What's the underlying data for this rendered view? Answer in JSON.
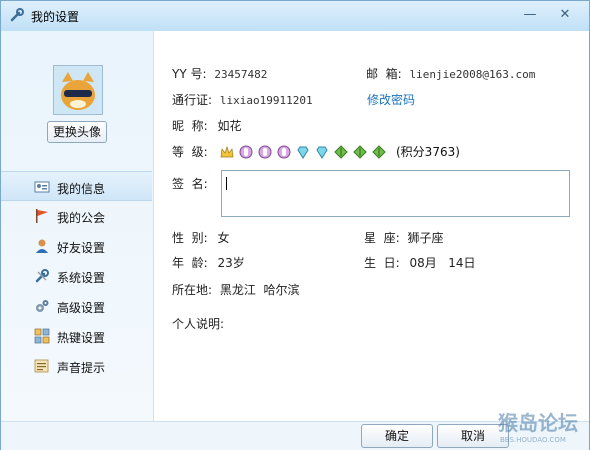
{
  "window": {
    "title": "我的设置",
    "min_icon": "minimize-icon",
    "close_icon": "close-icon"
  },
  "left": {
    "change_avatar_label": "更换头像",
    "nav": [
      {
        "label": "我的信息",
        "icon": "id-card-icon",
        "active": true
      },
      {
        "label": "我的公会",
        "icon": "flag-icon"
      },
      {
        "label": "好友设置",
        "icon": "user-icon"
      },
      {
        "label": "系统设置",
        "icon": "tools-icon"
      },
      {
        "label": "高级设置",
        "icon": "gears-icon"
      },
      {
        "label": "热键设置",
        "icon": "keys-icon"
      },
      {
        "label": "声音提示",
        "icon": "sound-icon"
      }
    ]
  },
  "info": {
    "yy_label": "YY 号:",
    "yy_value": "23457482",
    "email_label": "邮  箱:",
    "email_value": "lienjie2008@163.com",
    "pass_label": "通行证:",
    "pass_value": "lixiao19911201",
    "change_password": "修改密码",
    "nick_label": "昵  称:",
    "nick_value": "如花",
    "level_label": "等  级:",
    "points": "(积分3763)",
    "sign_label": "签  名:",
    "sign_value": "",
    "gender_label": "性  别:",
    "gender_value": "女",
    "star_label": "星  座:",
    "star_value": "狮子座",
    "age_label": "年  龄:",
    "age_value": "23岁",
    "birthday_label": "生  日:",
    "birthday_value": "08月   14日",
    "location_label": "所在地:",
    "location_value": "黑龙江  哈尔滨",
    "intro_label": "个人说明:"
  },
  "footer": {
    "ok": "确定",
    "cancel": "取消"
  },
  "watermark": {
    "text": "猴岛论坛",
    "sub": "BBS.HOUDAO.COM"
  },
  "colors": {
    "accent": "#1a74c1",
    "border": "#7aa7cc"
  }
}
